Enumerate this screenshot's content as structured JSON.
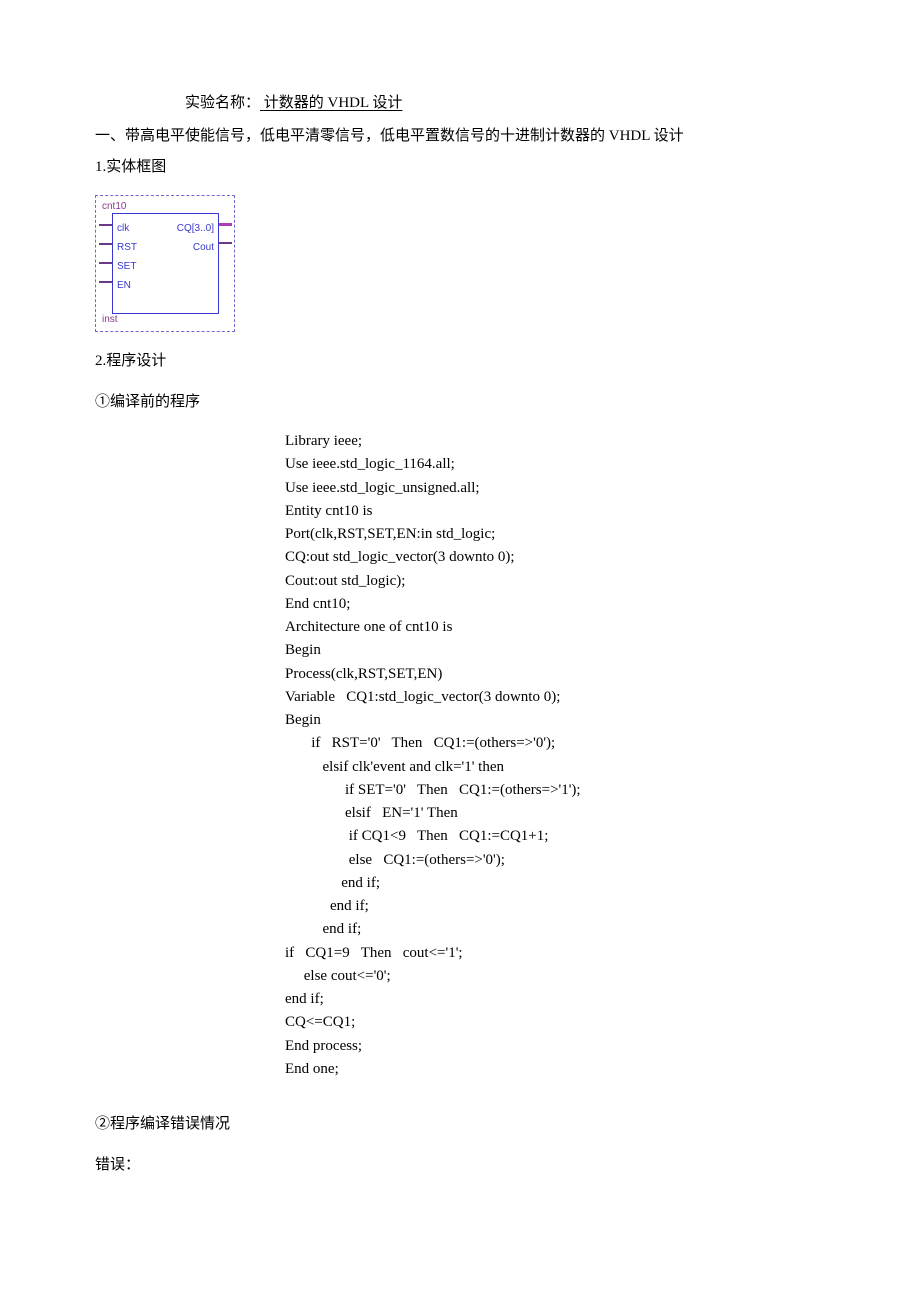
{
  "title": {
    "prefix": "实验名称：",
    "spacer": "        ",
    "main": "计数器的 VHDL 设计",
    "trailer": "        "
  },
  "section1": {
    "heading": "一、带高电平使能信号，低电平清零信号，低电平置数信号的十进制计数器的 VHDL 设计",
    "sub1": "1.实体框图",
    "sub2": "2.程序设计",
    "sub2_1": "①编译前的程序",
    "sub2_2": "②程序编译错误情况",
    "sub2_2_err": "错误："
  },
  "schematic": {
    "entity_name": "cnt10",
    "instance_name": "inst",
    "inputs": [
      "clk",
      "RST",
      "SET",
      "EN"
    ],
    "outputs": [
      "CQ[3..0]",
      "Cout"
    ]
  },
  "code": "Library ieee;\nUse ieee.std_logic_1164.all;\nUse ieee.std_logic_unsigned.all;\nEntity cnt10 is\nPort(clk,RST,SET,EN:in std_logic;\nCQ:out std_logic_vector(3 downto 0);\nCout:out std_logic);\nEnd cnt10;\nArchitecture one of cnt10 is\nBegin\nProcess(clk,RST,SET,EN)\nVariable   CQ1:std_logic_vector(3 downto 0);\nBegin\n       if   RST='0'   Then   CQ1:=(others=>'0');\n          elsif clk'event and clk='1' then\n                if SET='0'   Then   CQ1:=(others=>'1');\n                elsif   EN='1' Then\n                 if CQ1<9   Then   CQ1:=CQ1+1;\n                 else   CQ1:=(others=>'0');\n               end if;\n            end if;\n          end if;\nif   CQ1=9   Then   cout<='1';\n     else cout<='0';\nend if;\nCQ<=CQ1;\nEnd process;\nEnd one;"
}
